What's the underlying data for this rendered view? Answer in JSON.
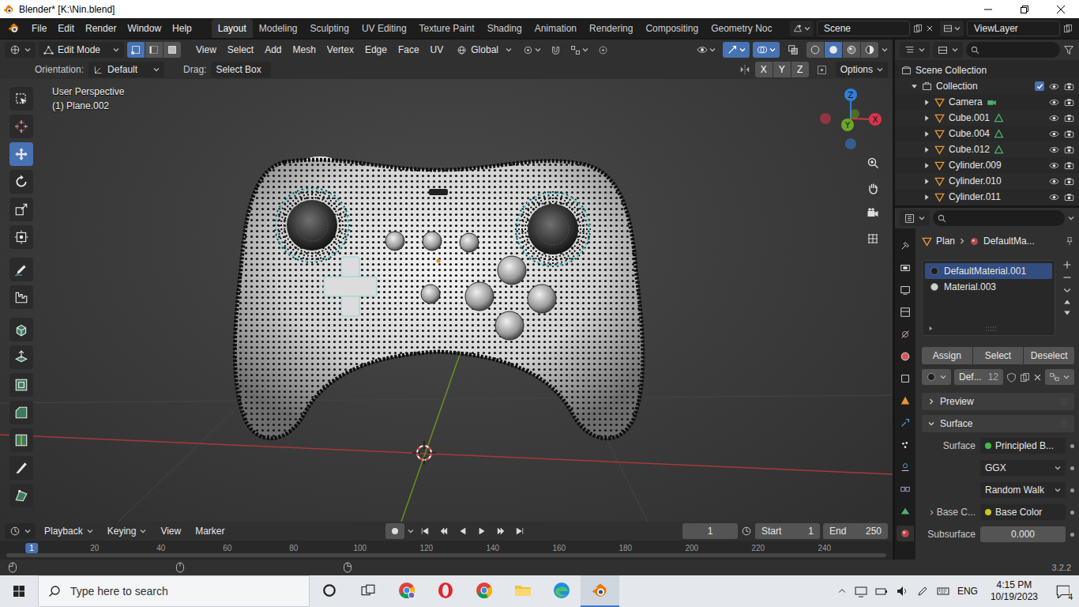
{
  "window": {
    "title": "Blender* [K:\\Nin.blend]"
  },
  "menu": [
    "File",
    "Edit",
    "Render",
    "Window",
    "Help"
  ],
  "workspaces": [
    {
      "label": "Layout",
      "selected": true
    },
    {
      "label": "Modeling",
      "selected": false
    },
    {
      "label": "Sculpting",
      "selected": false
    },
    {
      "label": "UV Editing",
      "selected": false
    },
    {
      "label": "Texture Paint",
      "selected": false
    },
    {
      "label": "Shading",
      "selected": false
    },
    {
      "label": "Animation",
      "selected": false
    },
    {
      "label": "Rendering",
      "selected": false
    },
    {
      "label": "Compositing",
      "selected": false
    },
    {
      "label": "Geometry Noc",
      "selected": false
    }
  ],
  "scene": "Scene",
  "view_layer": "ViewLayer",
  "viewport_header": {
    "mode": "Edit Mode",
    "select_modes": [
      {
        "kind": "vertex",
        "selected": true
      },
      {
        "kind": "edge",
        "selected": false
      },
      {
        "kind": "face",
        "selected": false
      }
    ],
    "menus": [
      "View",
      "Select",
      "Add",
      "Mesh",
      "Vertex",
      "Edge",
      "Face",
      "UV"
    ],
    "orientation": "Global",
    "snap": false,
    "gizmos": true,
    "overlays": true,
    "xray": false,
    "shading": [
      {
        "kind": "wireframe",
        "selected": false
      },
      {
        "kind": "solid",
        "selected": true
      },
      {
        "kind": "material",
        "selected": false
      },
      {
        "kind": "rendered",
        "selected": false
      }
    ]
  },
  "tool_settings": {
    "orientation_label": "Orientation:",
    "orientation": "Default",
    "drag_label": "Drag:",
    "drag": "Select Box",
    "mirror": [
      {
        "label": "X",
        "selected": false
      },
      {
        "label": "Y",
        "selected": false
      },
      {
        "label": "Z",
        "selected": false
      }
    ],
    "options": "Options"
  },
  "viewport": {
    "view_name": "User Perspective",
    "object": "(1) Plane.002",
    "gizmo": [
      {
        "label": "Z",
        "color": "#2f7fd8"
      },
      {
        "label": "Y",
        "color": "#6ba826"
      },
      {
        "label": "X",
        "color": "#d8334a"
      }
    ]
  },
  "tools": [
    {
      "kind": "select",
      "selected": false
    },
    {
      "kind": "cursor",
      "selected": false
    },
    {
      "kind": "move",
      "selected": true
    },
    {
      "kind": "rotate",
      "selected": false
    },
    {
      "kind": "scale",
      "selected": false
    },
    {
      "kind": "transform",
      "selected": false
    },
    {
      "kind": "annotate",
      "selected": false
    },
    {
      "kind": "measure",
      "selected": false
    },
    {
      "kind": "add-cube",
      "selected": false
    },
    {
      "kind": "extrude",
      "selected": false
    },
    {
      "kind": "inset",
      "selected": false
    },
    {
      "kind": "bevel",
      "selected": false
    },
    {
      "kind": "loop-cut",
      "selected": false
    },
    {
      "kind": "knife",
      "selected": false
    },
    {
      "kind": "poly-build",
      "selected": false
    }
  ],
  "outliner": {
    "root": "Scene Collection",
    "collection": {
      "name": "Collection",
      "checked": true,
      "expanded": true
    },
    "items": [
      {
        "name": "Camera",
        "kind": "camera",
        "expanded": false,
        "data_icon": true
      },
      {
        "name": "Cube.001",
        "kind": "mesh",
        "expanded": false,
        "data_icon": true
      },
      {
        "name": "Cube.004",
        "kind": "mesh",
        "expanded": false,
        "data_icon": true
      },
      {
        "name": "Cube.012",
        "kind": "mesh",
        "expanded": false,
        "data_icon": true
      },
      {
        "name": "Cylinder.009",
        "kind": "mesh",
        "expanded": false,
        "data_icon": false
      },
      {
        "name": "Cylinder.010",
        "kind": "mesh",
        "expanded": false,
        "data_icon": false
      },
      {
        "name": "Cylinder.011",
        "kind": "mesh",
        "expanded": false,
        "data_icon": false
      }
    ]
  },
  "properties": {
    "tabs": [
      {
        "selected": false
      },
      {
        "selected": false
      },
      {
        "selected": false
      },
      {
        "selected": false
      },
      {
        "selected": false
      },
      {
        "selected": false
      },
      {
        "selected": false
      },
      {
        "selected": false
      },
      {
        "selected": false
      },
      {
        "selected": false
      },
      {
        "selected": false
      },
      {
        "selected": false
      },
      {
        "selected": false
      },
      {
        "selected": true
      }
    ],
    "breadcrumb": [
      "Plan",
      "DefaultMa..."
    ],
    "slots": [
      {
        "name": "DefaultMaterial.001",
        "selected": true,
        "color": "#1e1e1e"
      },
      {
        "name": "Material.003",
        "selected": false,
        "color": "#d0d0d0"
      }
    ],
    "slot_buttons": [
      "Assign",
      "Select",
      "Deselect"
    ],
    "material": {
      "name": "Def...",
      "users": "12"
    },
    "panels": [
      {
        "label": "Preview",
        "expanded": false
      },
      {
        "label": "Surface",
        "expanded": true
      }
    ],
    "surface_rows": [
      {
        "kind": "socket",
        "label": "Surface",
        "value": "Principled B...",
        "color": "#3fbd4e",
        "expander": false
      },
      {
        "kind": "dropdown",
        "label": "",
        "value": "GGX",
        "color": "",
        "expander": false
      },
      {
        "kind": "dropdown",
        "label": "",
        "value": "Random Walk",
        "color": "",
        "expander": false
      },
      {
        "kind": "socket",
        "label": "Base C...",
        "value": "Base Color",
        "color": "#c7c729",
        "expander": true
      },
      {
        "kind": "number",
        "label": "Subsurface",
        "value": "0.000",
        "color": "",
        "expander": false
      }
    ]
  },
  "timeline": {
    "menus": [
      {
        "label": "Playback",
        "dropdown": true
      },
      {
        "label": "Keying",
        "dropdown": true
      },
      {
        "label": "View",
        "dropdown": false
      },
      {
        "label": "Marker",
        "dropdown": false
      }
    ],
    "auto_key": false,
    "current_frame": "1",
    "start_label": "Start",
    "start": "1",
    "end_label": "End",
    "end": "250",
    "ticks": [
      {
        "label": "1",
        "selected": true
      },
      {
        "label": "20",
        "selected": false
      },
      {
        "label": "40",
        "selected": false
      },
      {
        "label": "60",
        "selected": false
      },
      {
        "label": "80",
        "selected": false
      },
      {
        "label": "100",
        "selected": false
      },
      {
        "label": "120",
        "selected": false
      },
      {
        "label": "140",
        "selected": false
      },
      {
        "label": "160",
        "selected": false
      },
      {
        "label": "180",
        "selected": false
      },
      {
        "label": "200",
        "selected": false
      },
      {
        "label": "220",
        "selected": false
      },
      {
        "label": "240",
        "selected": false
      }
    ]
  },
  "status_bar": {
    "version": "3.2.2"
  },
  "taskbar": {
    "search_placeholder": "Type here to search",
    "apps": [
      {
        "selected": false
      },
      {
        "selected": false
      },
      {
        "selected": false
      },
      {
        "selected": false
      },
      {
        "selected": false
      },
      {
        "selected": true
      }
    ],
    "language": "ENG",
    "time": "4:15 PM",
    "date": "10/19/2023",
    "notifications": "4"
  }
}
